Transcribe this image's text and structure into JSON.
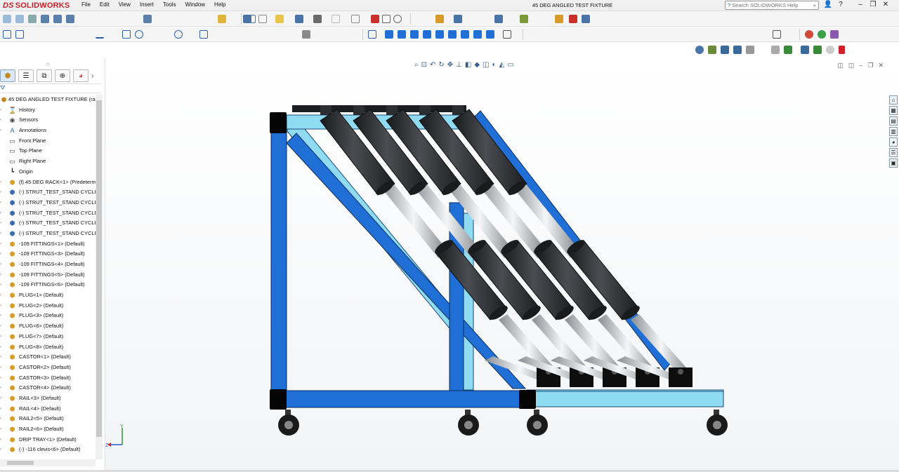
{
  "app": {
    "brand_prefix": "DS",
    "brand": "SOLIDWORKS"
  },
  "menu": [
    "File",
    "Edit",
    "View",
    "Insert",
    "Tools",
    "Window",
    "Help"
  ],
  "document_title": "45 DEG ANGLED TEST FIXTURE",
  "search": {
    "placeholder": "Search SOLIDWORKS Help"
  },
  "tree": [
    {
      "label": "45 DEG ANGLED TEST FIXTURE  (rac",
      "icon": "assembly-icon",
      "root": true
    },
    {
      "label": "History",
      "icon": "history-icon"
    },
    {
      "label": "Sensors",
      "icon": "sensors-icon"
    },
    {
      "label": "Annotations",
      "icon": "annotations-icon"
    },
    {
      "label": "Front Plane",
      "icon": "plane-icon"
    },
    {
      "label": "Top Plane",
      "icon": "plane-icon"
    },
    {
      "label": "Right Plane",
      "icon": "plane-icon"
    },
    {
      "label": "Origin",
      "icon": "origin-icon"
    },
    {
      "label": "(f) 45 DEG RACK<1> (Predeterm",
      "icon": "part-icon"
    },
    {
      "label": "(-) STRUT_TEST_STAND CYCLE-",
      "icon": "subassembly-icon"
    },
    {
      "label": "(-) STRUT_TEST_STAND CYCLE-",
      "icon": "subassembly-icon"
    },
    {
      "label": "(-) STRUT_TEST_STAND CYCLE-",
      "icon": "subassembly-icon"
    },
    {
      "label": "(-) STRUT_TEST_STAND CYCLE-",
      "icon": "subassembly-icon"
    },
    {
      "label": "(-) STRUT_TEST_STAND CYCLE-",
      "icon": "subassembly-icon"
    },
    {
      "label": "-109 FITTINGS<1> (Default)",
      "icon": "part-icon"
    },
    {
      "label": "-109 FITTINGS<3> (Default)",
      "icon": "part-icon"
    },
    {
      "label": "-109 FITTINGS<4> (Default)",
      "icon": "part-icon"
    },
    {
      "label": "-109 FITTINGS<5> (Default)",
      "icon": "part-icon"
    },
    {
      "label": "-109 FITTINGS<6> (Default)",
      "icon": "part-icon"
    },
    {
      "label": "PLUG<1> (Default)",
      "icon": "part-icon"
    },
    {
      "label": "PLUG<2> (Default)",
      "icon": "part-icon"
    },
    {
      "label": "PLUG<3> (Default)",
      "icon": "part-icon"
    },
    {
      "label": "PLUG<6> (Default)",
      "icon": "part-icon"
    },
    {
      "label": "PLUG<7> (Default)",
      "icon": "part-icon"
    },
    {
      "label": "PLUG<8> (Default)",
      "icon": "part-icon"
    },
    {
      "label": "CASTOR<1> (Default)",
      "icon": "part-icon"
    },
    {
      "label": "CASTOR<2> (Default)",
      "icon": "part-icon"
    },
    {
      "label": "CASTOR<3> (Default)",
      "icon": "part-icon"
    },
    {
      "label": "CASTOR<4> (Default)",
      "icon": "part-icon"
    },
    {
      "label": "RAIL<3> (Default)",
      "icon": "part-icon"
    },
    {
      "label": "RAIL<4> (Default)",
      "icon": "part-icon"
    },
    {
      "label": "RAIL2<5> (Default)",
      "icon": "part-icon"
    },
    {
      "label": "RAIL2<6> (Default)",
      "icon": "part-icon"
    },
    {
      "label": "DRIP TRAY<1> (Default)",
      "icon": "part-icon"
    },
    {
      "label": "(-) -116 clevis<6> (Default)",
      "icon": "part-icon"
    }
  ],
  "triad": {
    "x": "Z",
    "y": "Y"
  },
  "colors": {
    "frame_blue": "#1f6fd6",
    "frame_light": "#7fd6ef",
    "strut_black": "#2b2d30",
    "chrome": "#c8ccd0",
    "brand_red": "#d0202a"
  }
}
